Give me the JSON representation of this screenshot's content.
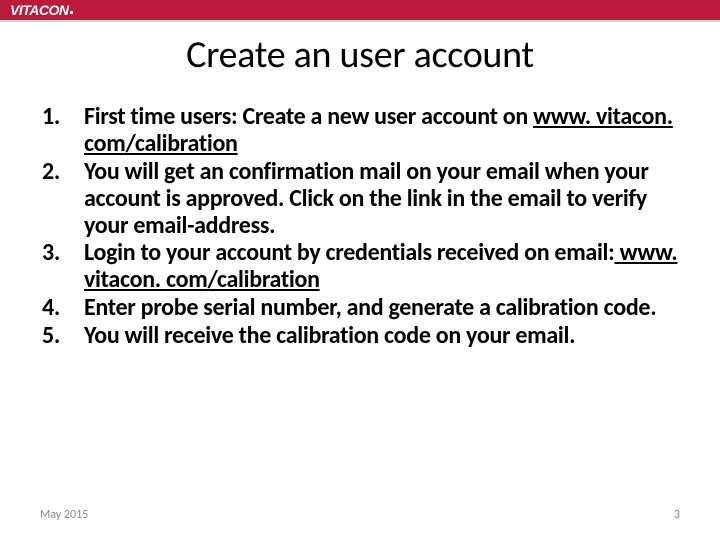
{
  "header": {
    "brand": "VITACON"
  },
  "title": "Create an user account",
  "steps": {
    "s1a": "First time users: Create a new user account on ",
    "s1link": "www. vitacon. com/calibration",
    "s2": "You will get an confirmation mail on your email when your account is approved. Click on the link in the email to verify your email-address.",
    "s3a": "Login to your account by credentials received on email:",
    "s3link": " www. vitacon. com/calibration",
    "s4": "Enter probe serial number, and generate a calibration code.",
    "s5": "You will receive the calibration code on your email."
  },
  "footer": {
    "date": "May 2015",
    "page": "3"
  }
}
